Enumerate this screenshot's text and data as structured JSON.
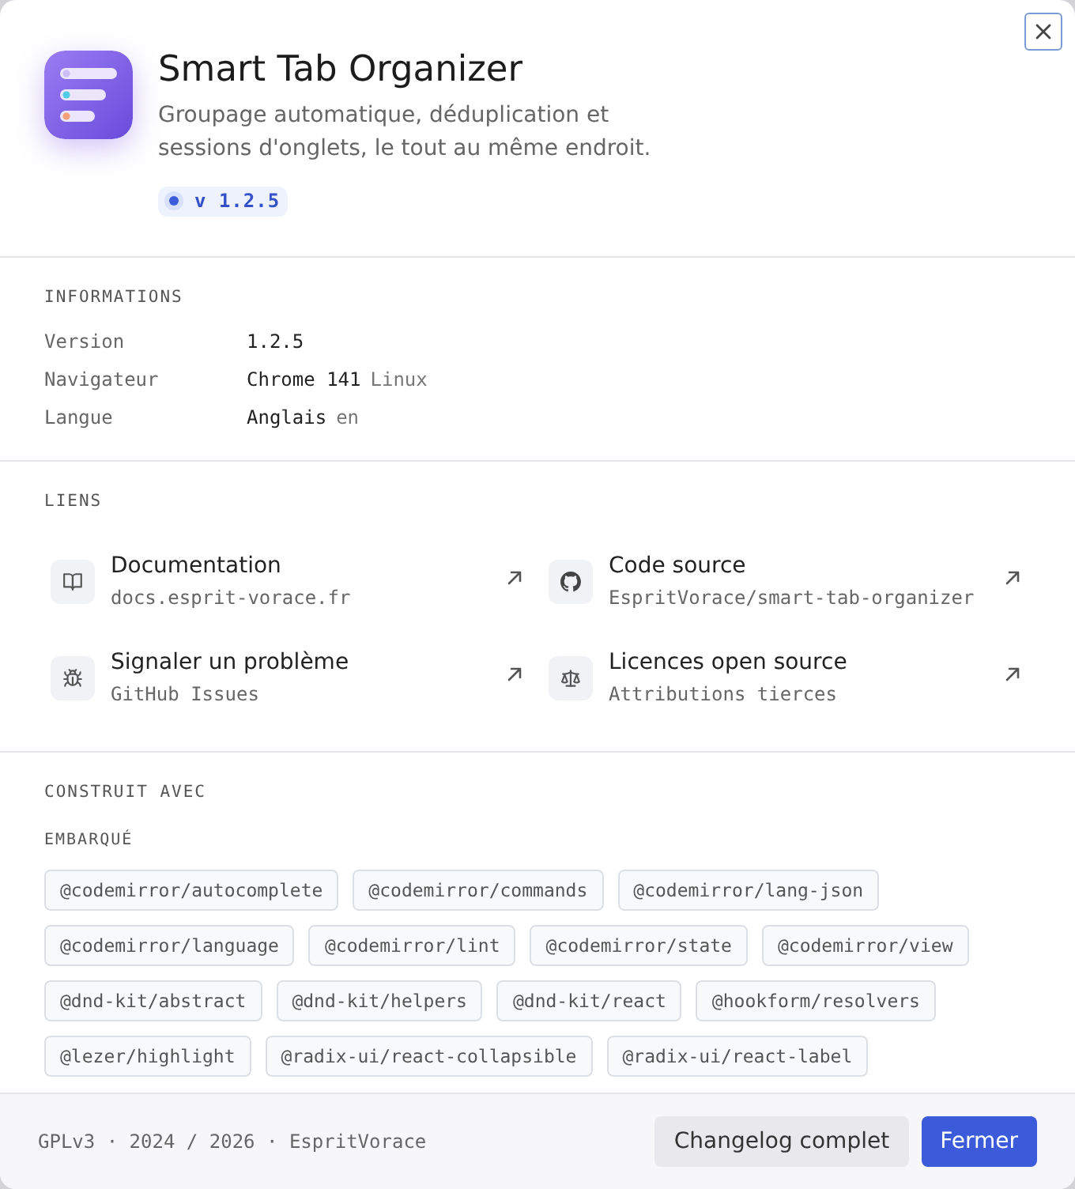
{
  "dialog": {
    "title": "Smart Tab Organizer",
    "description": "Groupage automatique, déduplication et sessions d'onglets, le tout au même endroit.",
    "version_badge": "v 1.2.5"
  },
  "info": {
    "heading": "INFORMATIONS",
    "rows": [
      {
        "label": "Version",
        "value": "1.2.5"
      },
      {
        "label": "Navigateur",
        "value": "Chrome 141",
        "detail": "Linux"
      },
      {
        "label": "Langue",
        "value": "Anglais",
        "detail": "en"
      }
    ]
  },
  "links": {
    "heading": "LIENS",
    "items": [
      {
        "title": "Documentation",
        "subtitle": "docs.esprit-vorace.fr"
      },
      {
        "title": "Code source",
        "subtitle": "EspritVorace/smart-tab-organizer"
      },
      {
        "title": "Signaler un problème",
        "subtitle": "GitHub Issues"
      },
      {
        "title": "Licences open source",
        "subtitle": "Attributions tierces"
      }
    ]
  },
  "built_with": {
    "heading": "CONSTRUIT AVEC",
    "groups": [
      {
        "heading": "EMBARQUÉ",
        "packages": [
          "@codemirror/autocomplete",
          "@codemirror/commands",
          "@codemirror/lang-json",
          "@codemirror/language",
          "@codemirror/lint",
          "@codemirror/state",
          "@codemirror/view",
          "@dnd-kit/abstract",
          "@dnd-kit/helpers",
          "@dnd-kit/react",
          "@hookform/resolvers",
          "@lezer/highlight",
          "@radix-ui/react-collapsible",
          "@radix-ui/react-label"
        ]
      }
    ]
  },
  "footer": {
    "text": "GPLv3 · 2024 / 2026 · EspritVorace",
    "buttons": [
      {
        "label": "Changelog complet",
        "kind": "secondary"
      },
      {
        "label": "Fermer",
        "kind": "primary"
      }
    ]
  }
}
